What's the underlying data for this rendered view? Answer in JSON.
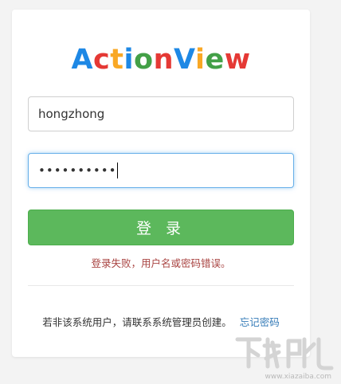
{
  "logo": {
    "text": "ActionView",
    "letters": [
      {
        "ch": "A",
        "color": "#1e88e5"
      },
      {
        "ch": "c",
        "color": "#e53935"
      },
      {
        "ch": "t",
        "color": "#f9a825"
      },
      {
        "ch": "i",
        "color": "#1e88e5"
      },
      {
        "ch": "o",
        "color": "#43a047"
      },
      {
        "ch": "n",
        "color": "#e53935"
      },
      {
        "ch": "V",
        "color": "#1e88e5"
      },
      {
        "ch": "i",
        "color": "#f9a825"
      },
      {
        "ch": "e",
        "color": "#43a047"
      },
      {
        "ch": "w",
        "color": "#e53935"
      }
    ]
  },
  "form": {
    "username_value": "hongzhong",
    "password_masked": "••••••••••",
    "login_label": "登 录",
    "error_message": "登录失败，用户名或密码错误。"
  },
  "footer": {
    "note": "若非该系统用户，请联系系统管理员创建。",
    "forgot_label": "忘记密码"
  },
  "watermark": {
    "brand": "下载吧",
    "domain": "www.xiazaiba.com"
  },
  "colors": {
    "button": "#5cb85c",
    "error": "#a94442",
    "link": "#337ab7",
    "focus": "#66afe9"
  }
}
